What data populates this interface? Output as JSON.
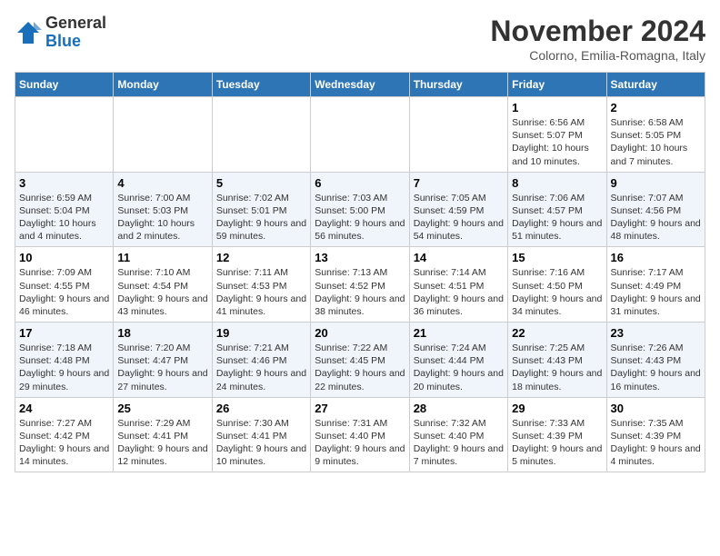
{
  "header": {
    "logo_line1": "General",
    "logo_line2": "Blue",
    "month": "November 2024",
    "location": "Colorno, Emilia-Romagna, Italy"
  },
  "weekdays": [
    "Sunday",
    "Monday",
    "Tuesday",
    "Wednesday",
    "Thursday",
    "Friday",
    "Saturday"
  ],
  "weeks": [
    [
      {
        "day": "",
        "info": ""
      },
      {
        "day": "",
        "info": ""
      },
      {
        "day": "",
        "info": ""
      },
      {
        "day": "",
        "info": ""
      },
      {
        "day": "",
        "info": ""
      },
      {
        "day": "1",
        "info": "Sunrise: 6:56 AM\nSunset: 5:07 PM\nDaylight: 10 hours and 10 minutes."
      },
      {
        "day": "2",
        "info": "Sunrise: 6:58 AM\nSunset: 5:05 PM\nDaylight: 10 hours and 7 minutes."
      }
    ],
    [
      {
        "day": "3",
        "info": "Sunrise: 6:59 AM\nSunset: 5:04 PM\nDaylight: 10 hours and 4 minutes."
      },
      {
        "day": "4",
        "info": "Sunrise: 7:00 AM\nSunset: 5:03 PM\nDaylight: 10 hours and 2 minutes."
      },
      {
        "day": "5",
        "info": "Sunrise: 7:02 AM\nSunset: 5:01 PM\nDaylight: 9 hours and 59 minutes."
      },
      {
        "day": "6",
        "info": "Sunrise: 7:03 AM\nSunset: 5:00 PM\nDaylight: 9 hours and 56 minutes."
      },
      {
        "day": "7",
        "info": "Sunrise: 7:05 AM\nSunset: 4:59 PM\nDaylight: 9 hours and 54 minutes."
      },
      {
        "day": "8",
        "info": "Sunrise: 7:06 AM\nSunset: 4:57 PM\nDaylight: 9 hours and 51 minutes."
      },
      {
        "day": "9",
        "info": "Sunrise: 7:07 AM\nSunset: 4:56 PM\nDaylight: 9 hours and 48 minutes."
      }
    ],
    [
      {
        "day": "10",
        "info": "Sunrise: 7:09 AM\nSunset: 4:55 PM\nDaylight: 9 hours and 46 minutes."
      },
      {
        "day": "11",
        "info": "Sunrise: 7:10 AM\nSunset: 4:54 PM\nDaylight: 9 hours and 43 minutes."
      },
      {
        "day": "12",
        "info": "Sunrise: 7:11 AM\nSunset: 4:53 PM\nDaylight: 9 hours and 41 minutes."
      },
      {
        "day": "13",
        "info": "Sunrise: 7:13 AM\nSunset: 4:52 PM\nDaylight: 9 hours and 38 minutes."
      },
      {
        "day": "14",
        "info": "Sunrise: 7:14 AM\nSunset: 4:51 PM\nDaylight: 9 hours and 36 minutes."
      },
      {
        "day": "15",
        "info": "Sunrise: 7:16 AM\nSunset: 4:50 PM\nDaylight: 9 hours and 34 minutes."
      },
      {
        "day": "16",
        "info": "Sunrise: 7:17 AM\nSunset: 4:49 PM\nDaylight: 9 hours and 31 minutes."
      }
    ],
    [
      {
        "day": "17",
        "info": "Sunrise: 7:18 AM\nSunset: 4:48 PM\nDaylight: 9 hours and 29 minutes."
      },
      {
        "day": "18",
        "info": "Sunrise: 7:20 AM\nSunset: 4:47 PM\nDaylight: 9 hours and 27 minutes."
      },
      {
        "day": "19",
        "info": "Sunrise: 7:21 AM\nSunset: 4:46 PM\nDaylight: 9 hours and 24 minutes."
      },
      {
        "day": "20",
        "info": "Sunrise: 7:22 AM\nSunset: 4:45 PM\nDaylight: 9 hours and 22 minutes."
      },
      {
        "day": "21",
        "info": "Sunrise: 7:24 AM\nSunset: 4:44 PM\nDaylight: 9 hours and 20 minutes."
      },
      {
        "day": "22",
        "info": "Sunrise: 7:25 AM\nSunset: 4:43 PM\nDaylight: 9 hours and 18 minutes."
      },
      {
        "day": "23",
        "info": "Sunrise: 7:26 AM\nSunset: 4:43 PM\nDaylight: 9 hours and 16 minutes."
      }
    ],
    [
      {
        "day": "24",
        "info": "Sunrise: 7:27 AM\nSunset: 4:42 PM\nDaylight: 9 hours and 14 minutes."
      },
      {
        "day": "25",
        "info": "Sunrise: 7:29 AM\nSunset: 4:41 PM\nDaylight: 9 hours and 12 minutes."
      },
      {
        "day": "26",
        "info": "Sunrise: 7:30 AM\nSunset: 4:41 PM\nDaylight: 9 hours and 10 minutes."
      },
      {
        "day": "27",
        "info": "Sunrise: 7:31 AM\nSunset: 4:40 PM\nDaylight: 9 hours and 9 minutes."
      },
      {
        "day": "28",
        "info": "Sunrise: 7:32 AM\nSunset: 4:40 PM\nDaylight: 9 hours and 7 minutes."
      },
      {
        "day": "29",
        "info": "Sunrise: 7:33 AM\nSunset: 4:39 PM\nDaylight: 9 hours and 5 minutes."
      },
      {
        "day": "30",
        "info": "Sunrise: 7:35 AM\nSunset: 4:39 PM\nDaylight: 9 hours and 4 minutes."
      }
    ]
  ]
}
